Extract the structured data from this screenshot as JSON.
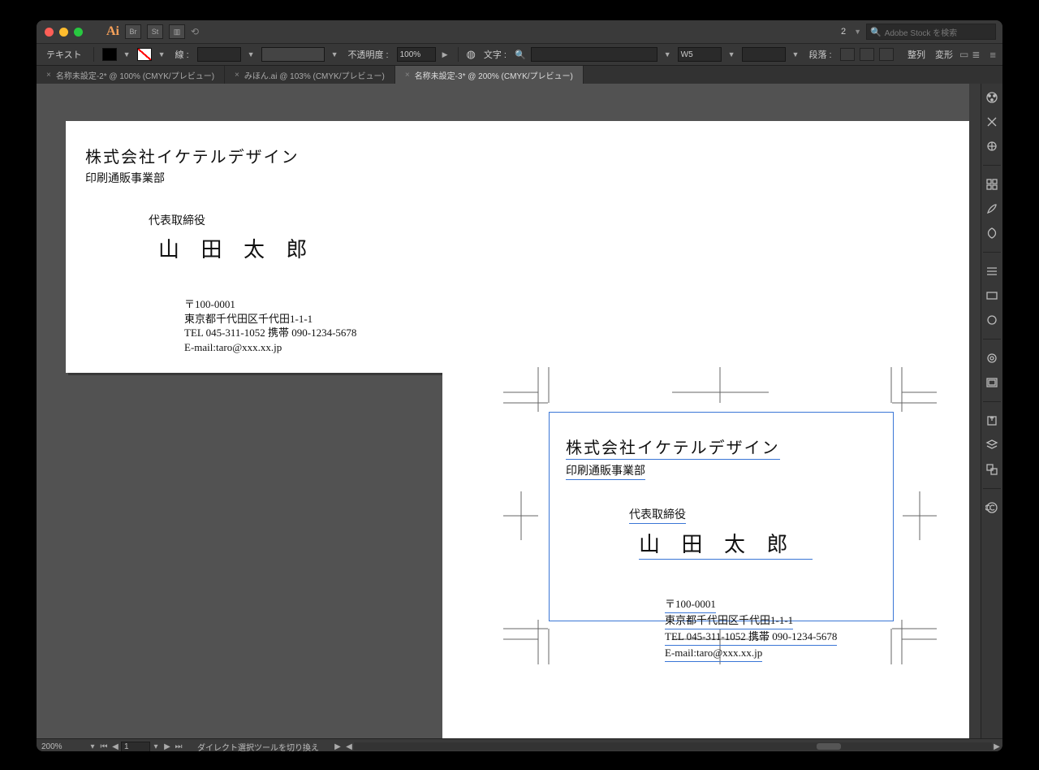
{
  "titlebar": {
    "logo": "Ai",
    "br": "Br",
    "st": "St",
    "doc_count": "2",
    "stock_placeholder": "Adobe Stock を検索"
  },
  "control": {
    "text_label": "テキスト",
    "stroke_label": "線 :",
    "opacity_label": "不透明度 :",
    "opacity_value": "100%",
    "char_label": "文字 :",
    "weight": "W5",
    "para_label": "段落 :",
    "align_label": "整列",
    "transform_label": "変形"
  },
  "tabs": [
    {
      "label": "名称未設定-2* @ 100% (CMYK/プレビュー)",
      "active": false
    },
    {
      "label": "みほん.ai @ 103% (CMYK/プレビュー)",
      "active": false
    },
    {
      "label": "名称未設定-3* @ 200% (CMYK/プレビュー)",
      "active": true
    }
  ],
  "card": {
    "company": "株式会社イケテルデザイン",
    "department": "印刷通販事業部",
    "title": "代表取締役",
    "name": "山 田 太 郎",
    "postal": "〒100-0001",
    "address": "東京都千代田区千代田1-1-1",
    "tel_line": "TEL 045-311-1052  携帯 090-1234-5678",
    "email_line": "E-mail:taro@xxx.xx.jp"
  },
  "status": {
    "zoom": "200%",
    "page": "1",
    "hint": "ダイレクト選択ツールを切り換え"
  }
}
